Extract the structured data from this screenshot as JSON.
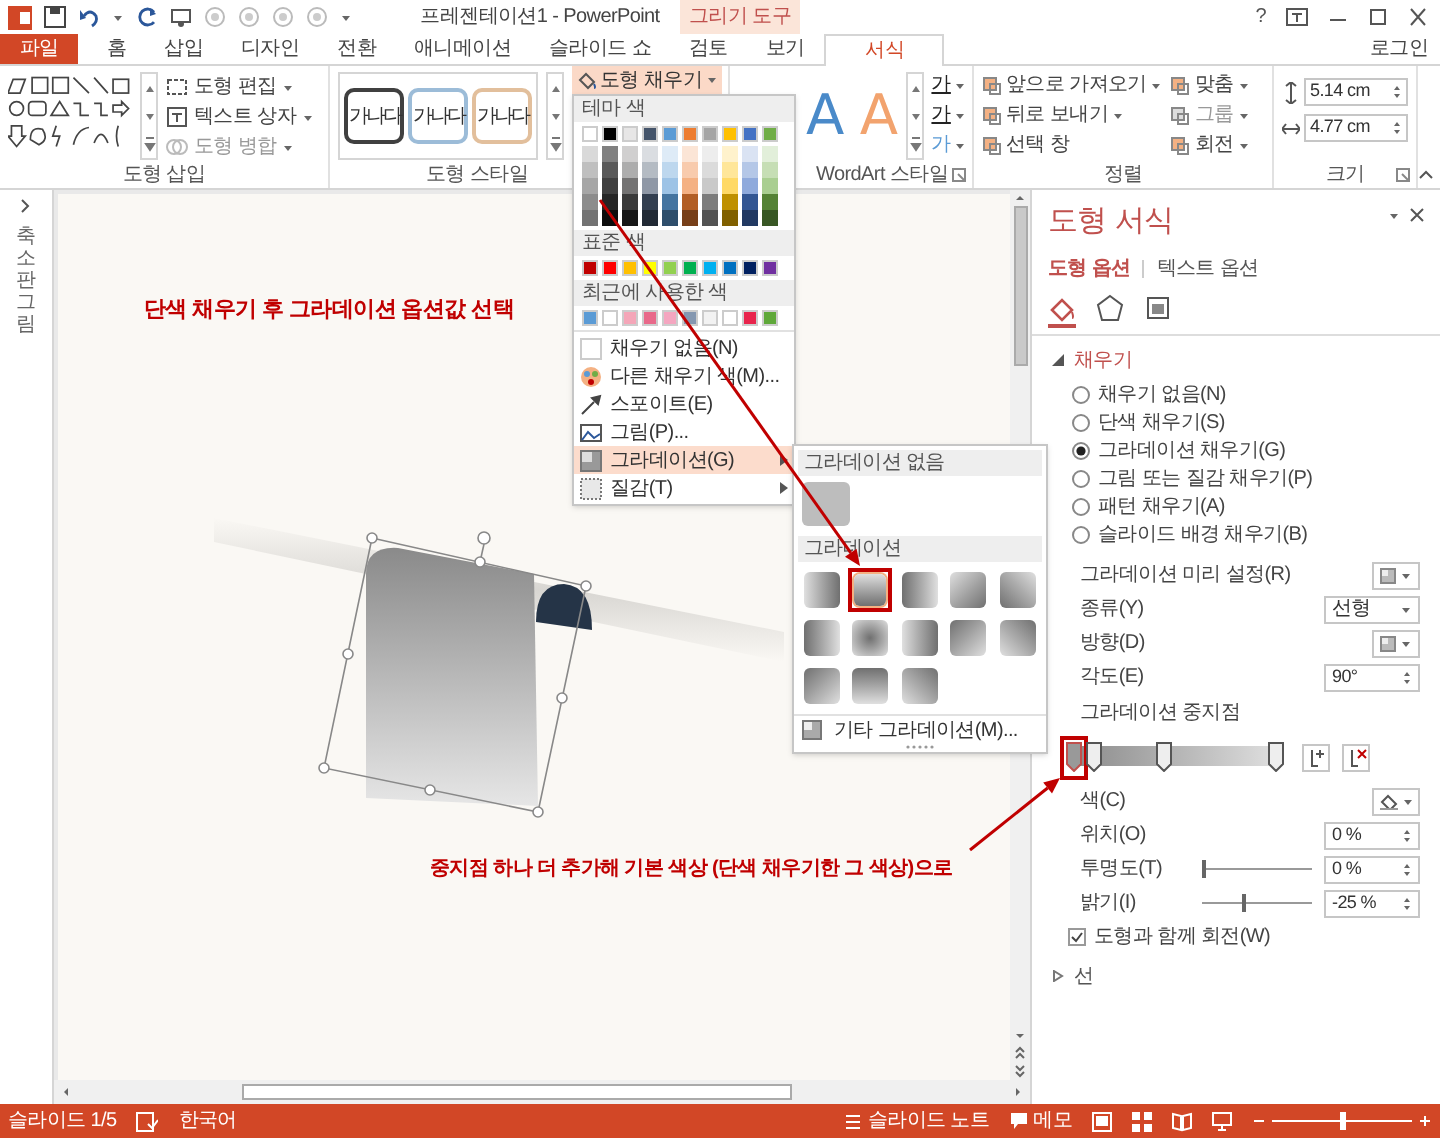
{
  "window": {
    "title": "프레젠테이션1 - PowerPoint",
    "tool_group": "그리기 도구",
    "help": "?",
    "account": "로그인"
  },
  "tabs": [
    {
      "label": "파일",
      "kind": "file",
      "selected": false
    },
    {
      "label": "홈",
      "kind": "normal",
      "selected": false
    },
    {
      "label": "삽입",
      "kind": "normal",
      "selected": false
    },
    {
      "label": "디자인",
      "kind": "normal",
      "selected": false
    },
    {
      "label": "전환",
      "kind": "normal",
      "selected": false
    },
    {
      "label": "애니메이션",
      "kind": "normal",
      "selected": false
    },
    {
      "label": "슬라이드 쇼",
      "kind": "normal",
      "selected": false
    },
    {
      "label": "검토",
      "kind": "normal",
      "selected": false
    },
    {
      "label": "보기",
      "kind": "normal",
      "selected": false
    },
    {
      "label": "서식",
      "kind": "contextual",
      "selected": true
    }
  ],
  "ribbon": {
    "shape_insert": {
      "label": "도형 삽입",
      "commands": [
        {
          "label": "도형 편집",
          "disabled": false
        },
        {
          "label": "텍스트 상자",
          "disabled": false
        },
        {
          "label": "도형 병합",
          "disabled": true
        }
      ]
    },
    "shape_styles": {
      "label": "도형 스타일",
      "samples": [
        {
          "text": "가나다",
          "color": "#404040"
        },
        {
          "text": "가나다",
          "color": "#9cbcd8"
        },
        {
          "text": "가나다",
          "color": "#e2bf9c"
        }
      ],
      "fill_button": {
        "label": "도형 채우기",
        "expanded": true
      }
    },
    "wordart": {
      "label": "WordArt 스타일",
      "samples": [
        {
          "text": "A",
          "color": "#4a8ac9"
        },
        {
          "text": "A",
          "color": "#f2a36e"
        }
      ],
      "text_buttons": [
        "가",
        "가",
        "가"
      ]
    },
    "arrange": {
      "label": "정렬",
      "commands": [
        {
          "label": "앞으로 가져오기",
          "disabled": false
        },
        {
          "label": "뒤로 보내기",
          "disabled": false
        },
        {
          "label": "선택 창",
          "disabled": false
        },
        {
          "label": "맞춤",
          "disabled": false
        },
        {
          "label": "그룹",
          "disabled": true
        },
        {
          "label": "회전",
          "disabled": false
        }
      ]
    },
    "size": {
      "label": "크기",
      "height": "5.14 cm",
      "width": "4.77 cm"
    }
  },
  "fill_menu": {
    "theme_heading": "테마 색",
    "theme_colors": [
      {
        "color": "#ffffff"
      },
      {
        "color": "#000000"
      },
      {
        "color": "#e7e6e6"
      },
      {
        "color": "#44546a"
      },
      {
        "color": "#5b9bd5"
      },
      {
        "color": "#ed7d31"
      },
      {
        "color": "#a5a5a5"
      },
      {
        "color": "#ffc000"
      },
      {
        "color": "#4472c4"
      },
      {
        "color": "#70ad47"
      }
    ],
    "standard_heading": "표준 색",
    "standard_colors": [
      {
        "color": "#c00000"
      },
      {
        "color": "#ff0000"
      },
      {
        "color": "#ffc000"
      },
      {
        "color": "#ffff00"
      },
      {
        "color": "#92d050"
      },
      {
        "color": "#00b050"
      },
      {
        "color": "#00b0f0"
      },
      {
        "color": "#0070c0"
      },
      {
        "color": "#002060"
      },
      {
        "color": "#7030a0"
      }
    ],
    "recent_heading": "최근에 사용한 색",
    "recent_colors": [
      {
        "color": "#5b9bd5"
      },
      {
        "color": "#ffffff"
      },
      {
        "color": "#f4a6b8"
      },
      {
        "color": "#e8698a"
      },
      {
        "color": "#f4a6c0"
      },
      {
        "color": "#8497b0"
      },
      {
        "color": "#f2f2f2"
      },
      {
        "color": "#ffffff"
      },
      {
        "color": "#e8244c"
      },
      {
        "color": "#5fa83a"
      }
    ],
    "items": [
      {
        "label": "채우기 없음(N)",
        "highlighted": false,
        "submenu": false
      },
      {
        "label": "다른 채우기 색(M)...",
        "highlighted": false,
        "submenu": false
      },
      {
        "label": "스포이트(E)",
        "highlighted": false,
        "submenu": false
      },
      {
        "label": "그림(P)...",
        "highlighted": false,
        "submenu": false
      },
      {
        "label": "그라데이션(G)",
        "highlighted": true,
        "submenu": true
      },
      {
        "label": "질감(T)",
        "highlighted": false,
        "submenu": true
      }
    ]
  },
  "gradient_menu": {
    "none_heading": "그라데이션 없음",
    "heading": "그라데이션",
    "variants": [
      {
        "selected": false
      },
      {
        "selected": true
      },
      {
        "selected": false
      },
      {
        "selected": false
      },
      {
        "selected": false
      },
      {
        "selected": false
      },
      {
        "selected": false
      },
      {
        "selected": false
      },
      {
        "selected": false
      },
      {
        "selected": false
      },
      {
        "selected": false
      },
      {
        "selected": false
      },
      {
        "selected": false
      }
    ],
    "more": "기타 그라데이션(M)..."
  },
  "thumbnail_pane": {
    "label": "축소판 그림"
  },
  "slide": {
    "notes": [
      "단색 채우기 후 그라데이션 옵션값 선택",
      "중지점 하나 더 추가해 기본 색상 (단색 채우기한 그 색상)으로"
    ]
  },
  "format_pane": {
    "title": "도형 서식",
    "tabs": [
      {
        "label": "도형 옵션",
        "selected": true
      },
      {
        "label": "텍스트 옵션",
        "selected": false
      }
    ],
    "icon_tabs": [
      {
        "selected": true
      },
      {
        "selected": false
      },
      {
        "selected": false
      }
    ],
    "fill": {
      "label": "채우기",
      "expanded": true,
      "options": [
        {
          "label": "채우기 없음(N)",
          "selected": false
        },
        {
          "label": "단색 채우기(S)",
          "selected": false
        },
        {
          "label": "그라데이션 채우기(G)",
          "selected": true
        },
        {
          "label": "그림 또는 질감 채우기(P)",
          "selected": false
        },
        {
          "label": "패턴 채우기(A)",
          "selected": false
        },
        {
          "label": "슬라이드 배경 채우기(B)",
          "selected": false
        }
      ],
      "preset": {
        "label": "그라데이션 미리 설정(R)"
      },
      "type": {
        "label": "종류(Y)",
        "value": "선형"
      },
      "direction": {
        "label": "방향(D)"
      },
      "angle": {
        "label": "각도(E)",
        "value": "90°"
      },
      "stops_label": "그라데이션 중지점",
      "stops": [
        {
          "level": 0,
          "selected": true
        },
        {
          "level": 0.1,
          "selected": false
        },
        {
          "level": 0.45,
          "selected": false
        },
        {
          "level": 1,
          "selected": false
        }
      ],
      "color": {
        "label": "색(C)"
      },
      "position": {
        "label": "위치(O)",
        "value": "0 %"
      },
      "transparency": {
        "label": "투명도(T)",
        "value": "0 %",
        "level": 0
      },
      "brightness": {
        "label": "밝기(I)",
        "value": "-25 %",
        "level": 0.375
      },
      "rotate_with_shape": {
        "label": "도형과 함께 회전(W)",
        "checked": true
      }
    },
    "line": {
      "label": "선",
      "expanded": false
    }
  },
  "status_bar": {
    "slide": "슬라이드 1/5",
    "language": "한국어",
    "notes": "슬라이드 노트",
    "comments": "메모",
    "zoom": {
      "level": 0.5
    }
  }
}
